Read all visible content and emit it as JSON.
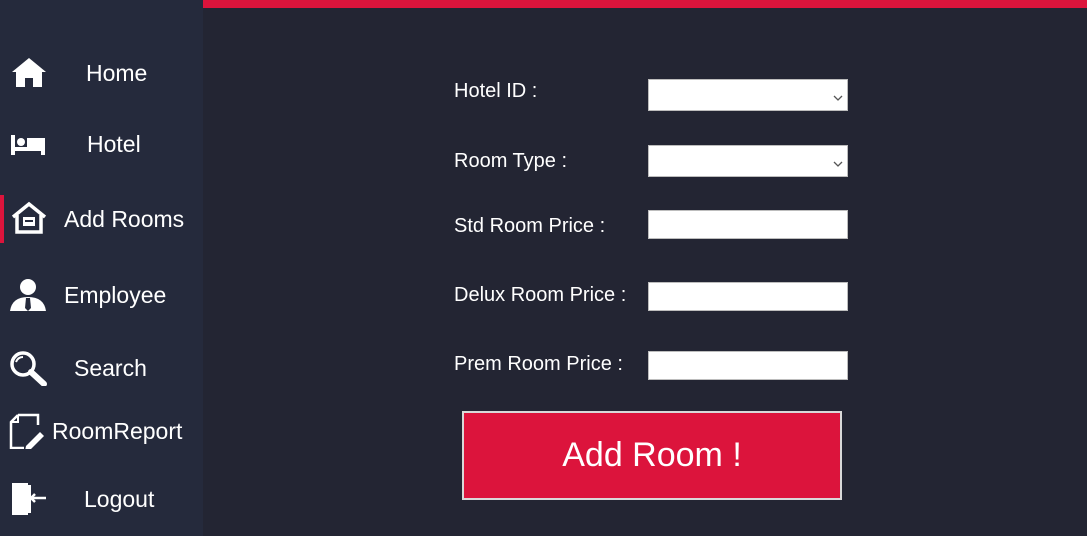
{
  "sidebar": {
    "items": [
      {
        "label": "Home",
        "icon": "home-icon"
      },
      {
        "label": "Hotel",
        "icon": "bed-icon"
      },
      {
        "label": "Add Rooms",
        "icon": "house-icon"
      },
      {
        "label": "Employee",
        "icon": "employee-icon"
      },
      {
        "label": "Search",
        "icon": "search-icon"
      },
      {
        "label": "RoomReport",
        "icon": "report-edit-icon"
      },
      {
        "label": "Logout",
        "icon": "logout-icon"
      }
    ],
    "active": "Add Rooms"
  },
  "form": {
    "hotel_id_label": "Hotel ID :",
    "hotel_id_value": "",
    "room_type_label": "Room Type :",
    "room_type_value": "",
    "std_price_label": "Std Room Price :",
    "std_price_value": "",
    "delux_price_label": "Delux Room Price :",
    "delux_price_value": "",
    "prem_price_label": "Prem Room Price :",
    "prem_price_value": "",
    "submit_label": "Add Room !"
  },
  "colors": {
    "accent": "#dc143c",
    "background": "#232533",
    "sidebar": "#252a3c"
  }
}
